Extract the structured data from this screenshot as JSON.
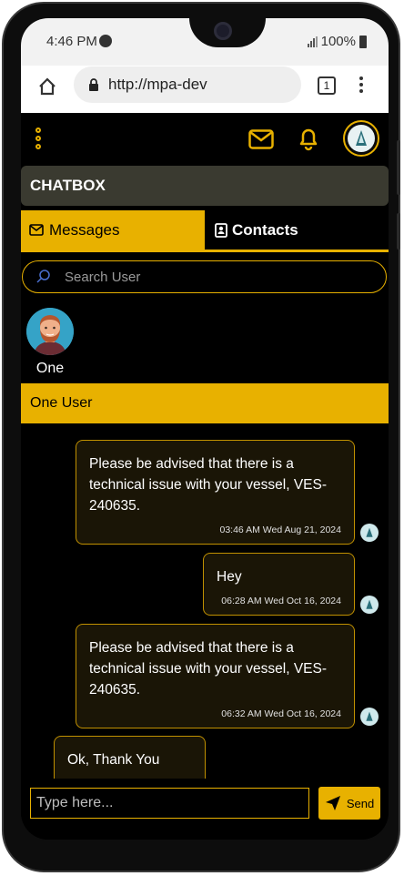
{
  "status_bar": {
    "time": "4:46 PM",
    "battery": "100%"
  },
  "browser": {
    "url": "http://mpa-dev",
    "tab_count": "1"
  },
  "app": {
    "header_title": "CHATBOX",
    "tabs": [
      {
        "label": "Messages",
        "active": true
      },
      {
        "label": "Contacts",
        "active": false
      }
    ],
    "search": {
      "placeholder": "Search User"
    },
    "users": [
      {
        "name": "One"
      }
    ],
    "active_chat": {
      "name": "One User"
    },
    "messages": [
      {
        "text": "Please be advised that there is a technical issue with your vessel, VES-240635.",
        "time": "03:46 AM Wed Aug 21, 2024",
        "side": "sent"
      },
      {
        "text": "Hey",
        "time": "06:28 AM Wed Oct 16, 2024",
        "side": "sent"
      },
      {
        "text": "Please be advised that there is a technical issue with your vessel, VES-240635.",
        "time": "06:32 AM Wed Oct 16, 2024",
        "side": "sent"
      },
      {
        "text": "Ok, Thank You",
        "time": "",
        "side": "received"
      }
    ],
    "composer": {
      "placeholder": "Type here...",
      "send_label": "Send"
    }
  },
  "colors": {
    "accent": "#e8b100",
    "background": "#000000",
    "header": "#3a3a30",
    "bubble": "#1a1506"
  }
}
